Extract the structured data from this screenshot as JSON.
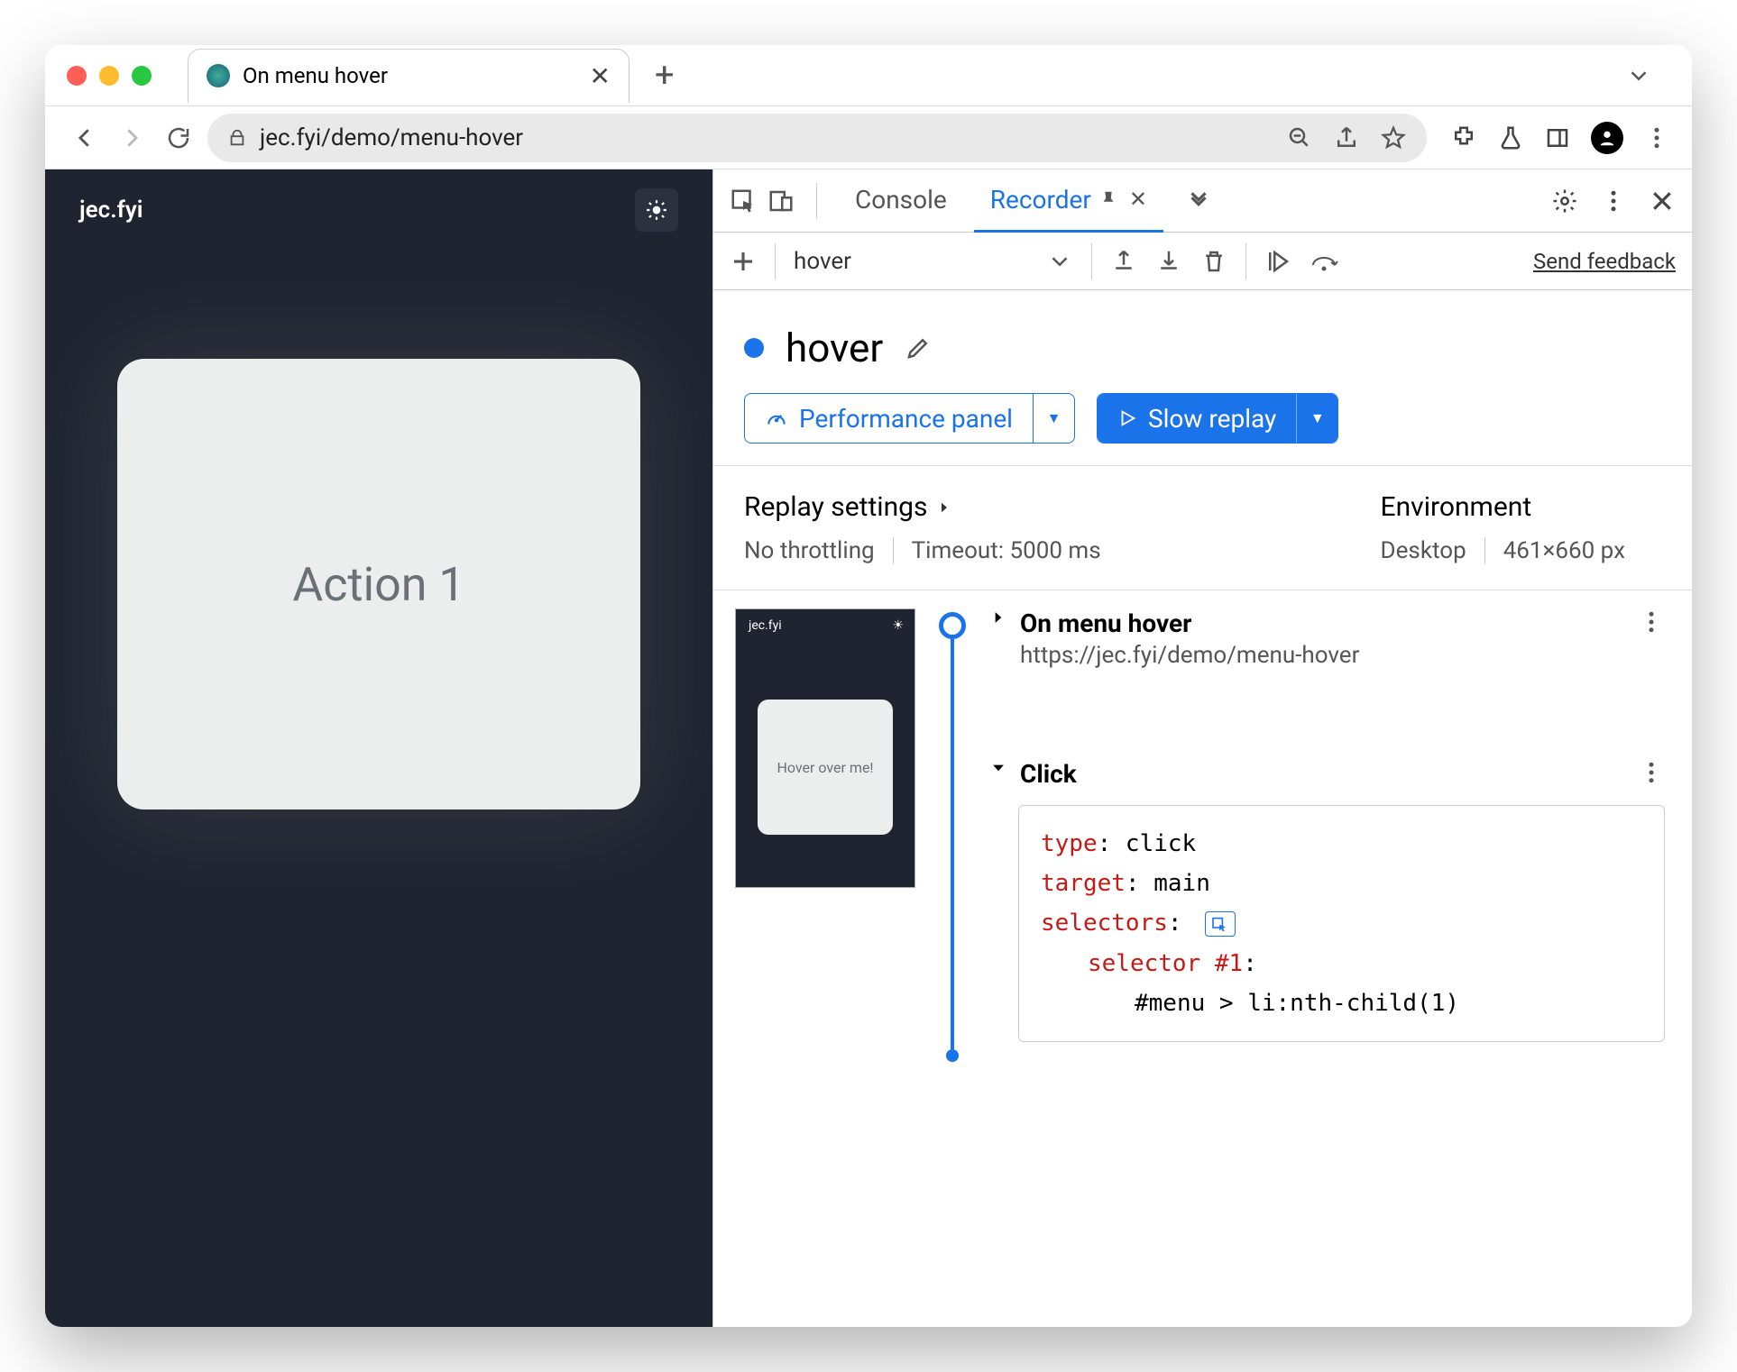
{
  "browser": {
    "tab_title": "On menu hover",
    "url_display": "jec.fyi/demo/menu-hover"
  },
  "page": {
    "brand": "jec.fyi",
    "card_text": "Action 1"
  },
  "devtools": {
    "tabs": {
      "console": "Console",
      "recorder": "Recorder"
    },
    "toolbar": {
      "recording_name": "hover",
      "feedback": "Send feedback"
    },
    "recording": {
      "title": "hover",
      "perf_button": "Performance panel",
      "replay_button": "Slow replay"
    },
    "settings": {
      "replay_heading": "Replay settings",
      "throttling": "No throttling",
      "timeout": "Timeout: 5000 ms",
      "env_heading": "Environment",
      "env_type": "Desktop",
      "env_size": "461×660 px"
    },
    "thumb": {
      "brand": "jec.fyi",
      "text": "Hover over me!"
    },
    "steps": {
      "nav_title": "On menu hover",
      "nav_url": "https://jec.fyi/demo/menu-hover",
      "click_label": "Click",
      "code": {
        "type_k": "type",
        "type_v": ": click",
        "target_k": "target",
        "target_v": ": main",
        "selectors_k": "selectors",
        "selectors_v": ":",
        "selector_k": "selector ",
        "selector_hash": "#1",
        "selector_colon": ":",
        "selector_val": "#menu > li:nth-child(1)"
      }
    }
  }
}
